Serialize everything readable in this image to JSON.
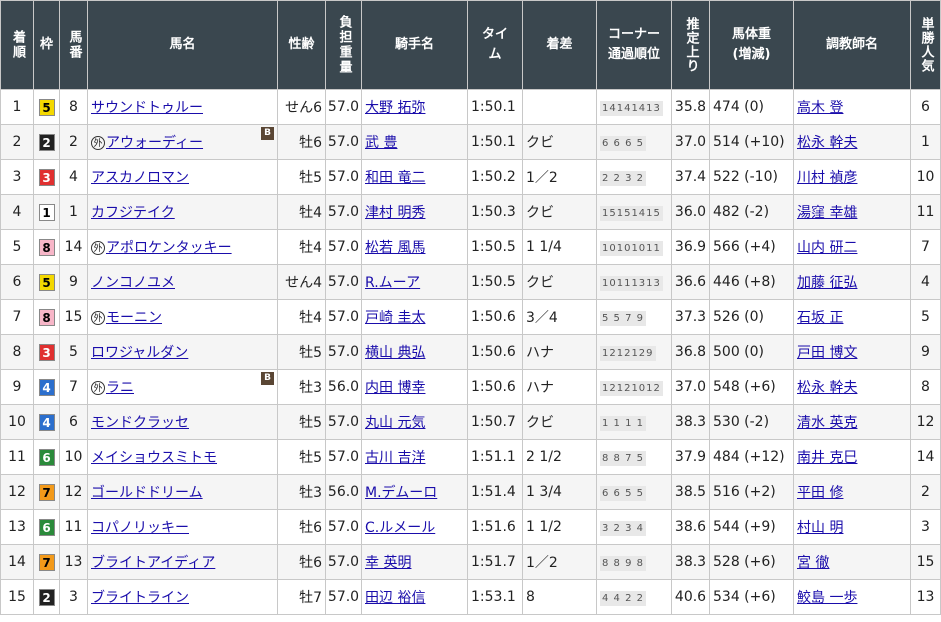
{
  "headers": {
    "rank": "着順",
    "waku": "枠",
    "umaban": "馬番",
    "horse": "馬名",
    "sexage": "性齢",
    "weight": "負担重量",
    "jockey": "騎手名",
    "time": "タイム",
    "margin": "着差",
    "corner": "コーナー通過順位",
    "last3f": "推定上り",
    "bodyweight": "馬体重(増減)",
    "trainer": "調教師名",
    "pop": "単勝人気"
  },
  "waku_colors": {
    "1": {
      "bg": "#ffffff",
      "fg": "#000000"
    },
    "2": {
      "bg": "#222222",
      "fg": "#ffffff"
    },
    "3": {
      "bg": "#e03030",
      "fg": "#ffffff"
    },
    "4": {
      "bg": "#2c6fcd",
      "fg": "#ffffff"
    },
    "5": {
      "bg": "#f4d800",
      "fg": "#000000"
    },
    "6": {
      "bg": "#2a8a3a",
      "fg": "#ffffff"
    },
    "7": {
      "bg": "#f39a1a",
      "fg": "#000000"
    },
    "8": {
      "bg": "#f7b6c8",
      "fg": "#000000"
    }
  },
  "rows": [
    {
      "rank": "1",
      "waku": "5",
      "umaban": "8",
      "foreign": false,
      "horse": "サウンドトゥルー",
      "blinker": false,
      "sexage": "せん6",
      "weight": "57.0",
      "jockey": "大野 拓弥",
      "time": "1:50.1",
      "margin": "",
      "corners": "14141413",
      "last3f": "35.8",
      "bodyweight": "474 (0)",
      "trainer": "高木 登",
      "pop": "6"
    },
    {
      "rank": "2",
      "waku": "2",
      "umaban": "2",
      "foreign": true,
      "horse": "アウォーディー",
      "blinker": true,
      "sexage": "牡6",
      "weight": "57.0",
      "jockey": "武 豊",
      "time": "1:50.1",
      "margin": "クビ",
      "corners": "6 6 6 5",
      "last3f": "37.0",
      "bodyweight": "514 (+10)",
      "trainer": "松永 幹夫",
      "pop": "1"
    },
    {
      "rank": "3",
      "waku": "3",
      "umaban": "4",
      "foreign": false,
      "horse": "アスカノロマン",
      "blinker": false,
      "sexage": "牡5",
      "weight": "57.0",
      "jockey": "和田 竜二",
      "time": "1:50.2",
      "margin": "1／2",
      "corners": "2 2 3 2",
      "last3f": "37.4",
      "bodyweight": "522 (-10)",
      "trainer": "川村 禎彦",
      "pop": "10"
    },
    {
      "rank": "4",
      "waku": "1",
      "umaban": "1",
      "foreign": false,
      "horse": "カフジテイク",
      "blinker": false,
      "sexage": "牡4",
      "weight": "57.0",
      "jockey": "津村 明秀",
      "time": "1:50.3",
      "margin": "クビ",
      "corners": "15151415",
      "last3f": "36.0",
      "bodyweight": "482 (-2)",
      "trainer": "湯窪 幸雄",
      "pop": "11"
    },
    {
      "rank": "5",
      "waku": "8",
      "umaban": "14",
      "foreign": true,
      "horse": "アポロケンタッキー",
      "blinker": false,
      "sexage": "牡4",
      "weight": "57.0",
      "jockey": "松若 風馬",
      "time": "1:50.5",
      "margin": "1 1/4",
      "corners": "10101011",
      "last3f": "36.9",
      "bodyweight": "566 (+4)",
      "trainer": "山内 研二",
      "pop": "7"
    },
    {
      "rank": "6",
      "waku": "5",
      "umaban": "9",
      "foreign": false,
      "horse": "ノンコノユメ",
      "blinker": false,
      "sexage": "せん4",
      "weight": "57.0",
      "jockey": "R.ムーア",
      "time": "1:50.5",
      "margin": "クビ",
      "corners": "10111313",
      "last3f": "36.6",
      "bodyweight": "446 (+8)",
      "trainer": "加藤 征弘",
      "pop": "4"
    },
    {
      "rank": "7",
      "waku": "8",
      "umaban": "15",
      "foreign": true,
      "horse": "モーニン",
      "blinker": false,
      "sexage": "牡4",
      "weight": "57.0",
      "jockey": "戸崎 圭太",
      "time": "1:50.6",
      "margin": "3／4",
      "corners": "5 5 7 9",
      "last3f": "37.3",
      "bodyweight": "526 (0)",
      "trainer": "石坂 正",
      "pop": "5"
    },
    {
      "rank": "8",
      "waku": "3",
      "umaban": "5",
      "foreign": false,
      "horse": "ロワジャルダン",
      "blinker": false,
      "sexage": "牡5",
      "weight": "57.0",
      "jockey": "横山 典弘",
      "time": "1:50.6",
      "margin": "ハナ",
      "corners": "1212129",
      "last3f": "36.8",
      "bodyweight": "500 (0)",
      "trainer": "戸田 博文",
      "pop": "9"
    },
    {
      "rank": "9",
      "waku": "4",
      "umaban": "7",
      "foreign": true,
      "horse": "ラニ",
      "blinker": true,
      "sexage": "牡3",
      "weight": "56.0",
      "jockey": "内田 博幸",
      "time": "1:50.6",
      "margin": "ハナ",
      "corners": "12121012",
      "last3f": "37.0",
      "bodyweight": "548 (+6)",
      "trainer": "松永 幹夫",
      "pop": "8"
    },
    {
      "rank": "10",
      "waku": "4",
      "umaban": "6",
      "foreign": false,
      "horse": "モンドクラッセ",
      "blinker": false,
      "sexage": "牡5",
      "weight": "57.0",
      "jockey": "丸山 元気",
      "time": "1:50.7",
      "margin": "クビ",
      "corners": "1 1 1 1",
      "last3f": "38.3",
      "bodyweight": "530 (-2)",
      "trainer": "清水 英克",
      "pop": "12"
    },
    {
      "rank": "11",
      "waku": "6",
      "umaban": "10",
      "foreign": false,
      "horse": "メイショウスミトモ",
      "blinker": false,
      "sexage": "牡5",
      "weight": "57.0",
      "jockey": "古川 吉洋",
      "time": "1:51.1",
      "margin": "2 1/2",
      "corners": "8 8 7 5",
      "last3f": "37.9",
      "bodyweight": "484 (+12)",
      "trainer": "南井 克巳",
      "pop": "14"
    },
    {
      "rank": "12",
      "waku": "7",
      "umaban": "12",
      "foreign": false,
      "horse": "ゴールドドリーム",
      "blinker": false,
      "sexage": "牡3",
      "weight": "56.0",
      "jockey": "M.デムーロ",
      "time": "1:51.4",
      "margin": "1 3/4",
      "corners": "6 6 5 5",
      "last3f": "38.5",
      "bodyweight": "516 (+2)",
      "trainer": "平田 修",
      "pop": "2"
    },
    {
      "rank": "13",
      "waku": "6",
      "umaban": "11",
      "foreign": false,
      "horse": "コパノリッキー",
      "blinker": false,
      "sexage": "牡6",
      "weight": "57.0",
      "jockey": "C.ルメール",
      "time": "1:51.6",
      "margin": "1 1/2",
      "corners": "3 2 3 4",
      "last3f": "38.6",
      "bodyweight": "544 (+9)",
      "trainer": "村山 明",
      "pop": "3"
    },
    {
      "rank": "14",
      "waku": "7",
      "umaban": "13",
      "foreign": false,
      "horse": "ブライトアイディア",
      "blinker": false,
      "sexage": "牡6",
      "weight": "57.0",
      "jockey": "幸 英明",
      "time": "1:51.7",
      "margin": "1／2",
      "corners": "8 8 9 8",
      "last3f": "38.3",
      "bodyweight": "528 (+6)",
      "trainer": "宮 徹",
      "pop": "15"
    },
    {
      "rank": "15",
      "waku": "2",
      "umaban": "3",
      "foreign": false,
      "horse": "ブライトライン",
      "blinker": false,
      "sexage": "牡7",
      "weight": "57.0",
      "jockey": "田辺 裕信",
      "time": "1:53.1",
      "margin": "8",
      "corners": "4 4 2 2",
      "last3f": "40.6",
      "bodyweight": "534 (+6)",
      "trainer": "鮫島 一歩",
      "pop": "13"
    }
  ]
}
